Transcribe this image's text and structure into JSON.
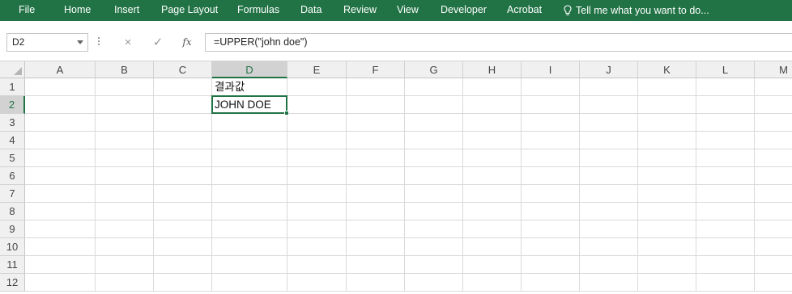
{
  "ribbon": {
    "tabs": [
      "File",
      "Home",
      "Insert",
      "Page Layout",
      "Formulas",
      "Data",
      "Review",
      "View",
      "Developer",
      "Acrobat"
    ],
    "tell_me": "Tell me what you want to do..."
  },
  "colors": {
    "accent": "#217346"
  },
  "formula_bar": {
    "name_box": "D2",
    "cancel_icon": "×",
    "enter_icon": "✓",
    "fx_label": "fx",
    "formula": "=UPPER(\"john doe\")"
  },
  "grid": {
    "columns": [
      "A",
      "B",
      "C",
      "D",
      "E",
      "F",
      "G",
      "H",
      "I",
      "J",
      "K",
      "L",
      "M"
    ],
    "rows": [
      "1",
      "2",
      "3",
      "4",
      "5",
      "6",
      "7",
      "8",
      "9",
      "10",
      "11",
      "12"
    ],
    "selected_column": "D",
    "selected_row": "2",
    "cells": {
      "D1": "결과값",
      "D2": "JOHN DOE"
    }
  }
}
